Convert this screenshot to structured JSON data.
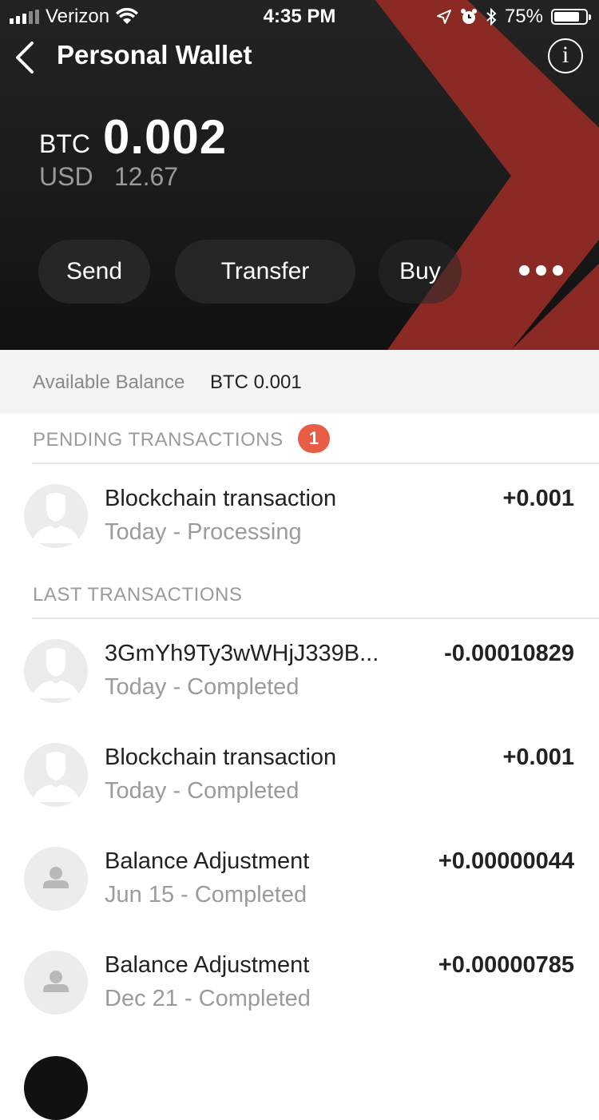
{
  "status_bar": {
    "carrier": "Verizon",
    "time": "4:35 PM",
    "battery": "75%",
    "battery_level": 0.75
  },
  "header": {
    "title": "Personal Wallet",
    "balance_currency": "BTC",
    "balance_amount": "0.002",
    "usd_label": "USD",
    "usd_amount": "12.67",
    "accent_color": "#8b2a25"
  },
  "actions": {
    "send": "Send",
    "transfer": "Transfer",
    "buy": "Buy",
    "more_icon": "more-dots-icon"
  },
  "available": {
    "label": "Available Balance",
    "value": "BTC 0.001"
  },
  "pending": {
    "heading": "PENDING TRANSACTIONS",
    "count": "1",
    "items": [
      {
        "name": "Blockchain transaction",
        "sub": "Today - Processing",
        "amount": "+0.001",
        "avatar": "person-silhouette-icon"
      }
    ]
  },
  "last": {
    "heading": "LAST TRANSACTIONS",
    "items": [
      {
        "name": "3GmYh9Ty3wWHjJ339B...",
        "sub": "Today - Completed",
        "amount": "-0.00010829",
        "avatar": "person-silhouette-icon"
      },
      {
        "name": "Blockchain transaction",
        "sub": "Today - Completed",
        "amount": "+0.001",
        "avatar": "person-silhouette-icon"
      },
      {
        "name": "Balance Adjustment",
        "sub": "Jun 15 - Completed",
        "amount": "+0.00000044",
        "avatar": "user-icon"
      },
      {
        "name": "Balance Adjustment",
        "sub": "Dec 21 - Completed",
        "amount": "+0.00000785",
        "avatar": "user-icon"
      }
    ]
  }
}
